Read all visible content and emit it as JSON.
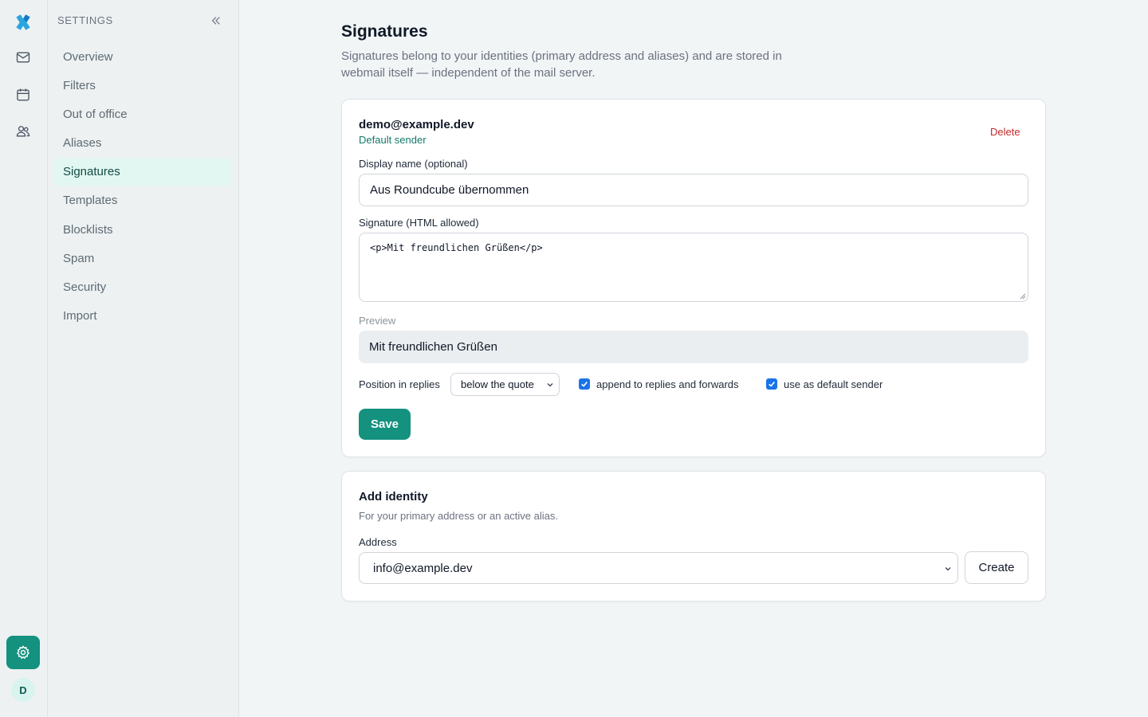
{
  "icons": {
    "logo": "app-logo-icon",
    "mail": "mail-icon",
    "calendar": "calendar-icon",
    "contacts": "contacts-icon",
    "settings": "gear-icon",
    "collapse": "double-chevron-left-icon"
  },
  "colors": {
    "accent": "#14917f",
    "accent_light": "#e2f7f1",
    "danger": "#c22a2a",
    "checkbox": "#1a73e8"
  },
  "user": {
    "avatar_initial": "D"
  },
  "sidebar": {
    "title": "SETTINGS",
    "items": [
      {
        "label": "Overview",
        "active": false
      },
      {
        "label": "Filters",
        "active": false
      },
      {
        "label": "Out of office",
        "active": false
      },
      {
        "label": "Aliases",
        "active": false
      },
      {
        "label": "Signatures",
        "active": true
      },
      {
        "label": "Templates",
        "active": false
      },
      {
        "label": "Blocklists",
        "active": false
      },
      {
        "label": "Spam",
        "active": false
      },
      {
        "label": "Security",
        "active": false
      },
      {
        "label": "Import",
        "active": false
      }
    ]
  },
  "main": {
    "title": "Signatures",
    "description": "Signatures belong to your identities (primary address and aliases) and are stored in webmail itself — independent of the mail server."
  },
  "identity": {
    "email": "demo@example.dev",
    "badge": "Default sender",
    "delete_label": "Delete",
    "display_name_label": "Display name (optional)",
    "display_name_value": "Aus Roundcube übernommen",
    "signature_label": "Signature (HTML allowed)",
    "signature_value": "<p>Mit freundlichen Grüßen</p>",
    "preview_label": "Preview",
    "preview_text": "Mit freundlichen Grüßen",
    "position_label": "Position in replies",
    "position_value": "below the quote",
    "append_label": "append to replies and forwards",
    "append_checked": true,
    "default_label": "use as default sender",
    "default_checked": true,
    "save_label": "Save"
  },
  "add_identity": {
    "title": "Add identity",
    "description": "For your primary address or an active alias.",
    "address_label": "Address",
    "address_value": "info@example.dev",
    "create_label": "Create"
  }
}
